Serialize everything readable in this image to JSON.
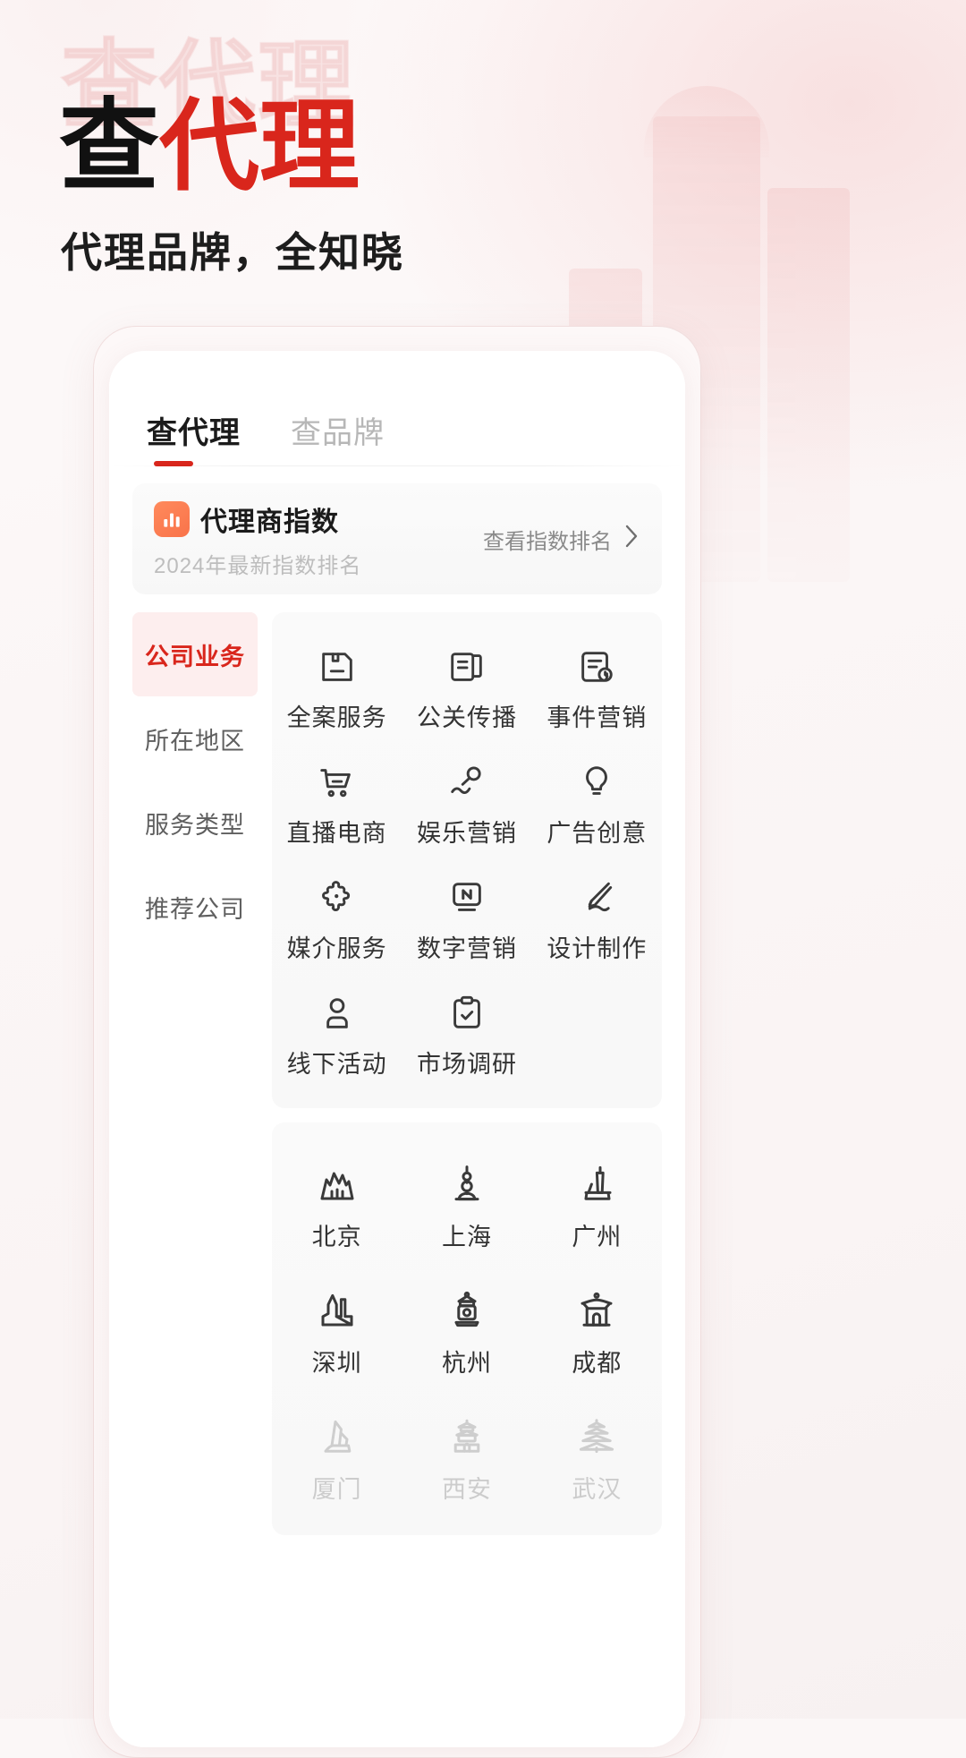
{
  "hero": {
    "ghost_title": "查代理",
    "title_black": "查",
    "title_red": "代理",
    "subtitle": "代理品牌，全知晓",
    "accent_red": "#d9261c",
    "title_black_color": "#111111"
  },
  "app": {
    "tabs": [
      {
        "label": "查代理",
        "active": true
      },
      {
        "label": "查品牌",
        "active": false
      }
    ],
    "index_card": {
      "badge_icon": "bar-chart-icon",
      "badge_color": "#f9734a",
      "title": "代理商指数",
      "subtitle": "2024年最新指数排名",
      "link_label": "查看指数排名",
      "link_chevron": "›"
    },
    "sidebar": [
      {
        "label": "公司业务",
        "active": true
      },
      {
        "label": "所在地区",
        "active": false
      },
      {
        "label": "服务类型",
        "active": false
      },
      {
        "label": "推荐公司",
        "active": false
      }
    ],
    "services": [
      {
        "label": "全案服务",
        "icon": "document-save-icon"
      },
      {
        "label": "公关传播",
        "icon": "book-page-icon"
      },
      {
        "label": "事件营销",
        "icon": "document-clock-icon"
      },
      {
        "label": "直播电商",
        "icon": "shopping-cart-icon"
      },
      {
        "label": "娱乐营销",
        "icon": "microphone-icon"
      },
      {
        "label": "广告创意",
        "icon": "lightbulb-icon"
      },
      {
        "label": "媒介服务",
        "icon": "puzzle-piece-icon"
      },
      {
        "label": "数字营销",
        "icon": "n-monitor-icon"
      },
      {
        "label": "设计制作",
        "icon": "pen-stroke-icon"
      },
      {
        "label": "线下活动",
        "icon": "person-icon"
      },
      {
        "label": "市场调研",
        "icon": "clipboard-check-icon"
      }
    ],
    "cities": [
      {
        "label": "北京",
        "icon": "great-wall-icon",
        "opacity": "full"
      },
      {
        "label": "上海",
        "icon": "oriental-pearl-tower-icon",
        "opacity": "full"
      },
      {
        "label": "广州",
        "icon": "canton-tower-icon",
        "opacity": "full"
      },
      {
        "label": "深圳",
        "icon": "shenzhen-skyline-icon",
        "opacity": "full"
      },
      {
        "label": "杭州",
        "icon": "pagoda-lantern-icon",
        "opacity": "full"
      },
      {
        "label": "成都",
        "icon": "chengdu-gate-icon",
        "opacity": "full"
      },
      {
        "label": "厦门",
        "icon": "xiamen-sail-icon",
        "opacity": "faded"
      },
      {
        "label": "西安",
        "icon": "xian-bell-tower-icon",
        "opacity": "faded"
      },
      {
        "label": "武汉",
        "icon": "yellow-crane-tower-icon",
        "opacity": "faded"
      }
    ]
  }
}
